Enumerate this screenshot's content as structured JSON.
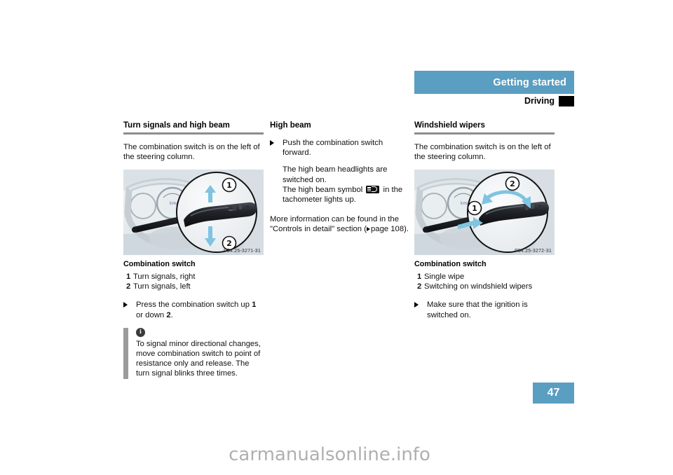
{
  "header": {
    "section_title": "Getting started",
    "subsection_title": "Driving",
    "bar_color": "#5a9ec2",
    "tab_color": "#000000"
  },
  "page_number": "47",
  "footer_watermark": "carmanualsonline.info",
  "columns": {
    "left": {
      "heading": "Turn signals and high beam",
      "intro": "The combination switch is on the left of the steering column.",
      "figure": {
        "watermark": "P54.25-3271-31",
        "alt": "Steering column combination switch with magnified detail circle",
        "callout_1": "1",
        "callout_2": "2"
      },
      "caption_heading": "Combination switch",
      "legend": [
        {
          "num": "1",
          "text": "Turn signals, right"
        },
        {
          "num": "2",
          "text": "Turn signals, left"
        }
      ],
      "bullet_1_a": "Press the combination switch up ",
      "bullet_1_b": "1",
      "bullet_1_c": " or down ",
      "bullet_1_d": "2",
      "bullet_1_e": ".",
      "note": {
        "icon": "info-icon",
        "text": "To signal minor directional changes, move combination switch to point of resistance only and release. The turn signal blinks three times."
      }
    },
    "middle": {
      "heading": "High beam",
      "bullet_1": "Push the combination switch forward.",
      "bullet_1_cont_a": "The high beam headlights are switched on.",
      "bullet_1_cont_b": "The high beam symbol ",
      "bullet_1_cont_c": " in the tachometer lights up.",
      "ref_a": "More information can be found in the \"Controls in detail\" section (",
      "ref_b": "page 108).",
      "symbol_name": "high-beam-indicator-icon"
    },
    "right": {
      "heading": "Windshield wipers",
      "intro": "The combination switch is on the left of the steering column.",
      "figure": {
        "watermark": "P54.25-3272-31",
        "alt": "Steering column combination switch with magnified detail circle showing wiper functions",
        "callout_1": "1",
        "callout_2": "2"
      },
      "caption_heading": "Combination switch",
      "legend": [
        {
          "num": "1",
          "text": "Single wipe"
        },
        {
          "num": "2",
          "text": "Switching on windshield wipers"
        }
      ],
      "bullet_1": "Make sure that the ignition is switched on."
    }
  }
}
